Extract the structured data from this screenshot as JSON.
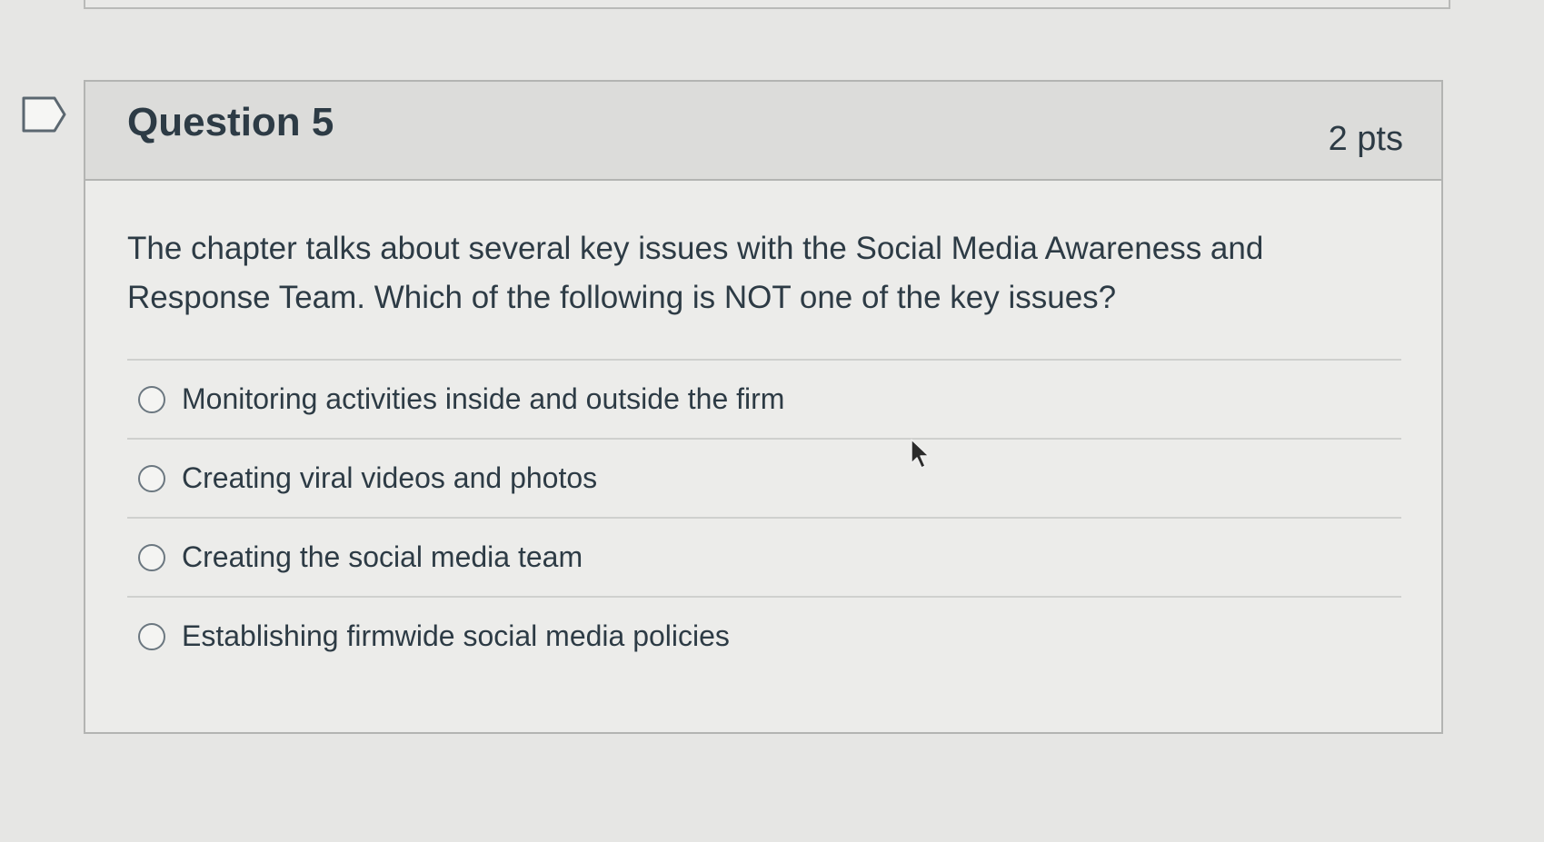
{
  "question": {
    "title": "Question 5",
    "points": "2 pts",
    "text": "The chapter talks about several key issues with the Social Media Awareness and Response Team. Which of the following is NOT one of the key issues?",
    "answers": [
      {
        "label": "Monitoring activities inside and outside the firm",
        "selected": false
      },
      {
        "label": "Creating viral videos and photos",
        "selected": false
      },
      {
        "label": "Creating the social media team",
        "selected": false
      },
      {
        "label": "Establishing firmwide social media policies",
        "selected": false
      }
    ]
  },
  "icons": {
    "flag": "flag-question-icon",
    "cursor": "mouse-pointer-icon"
  },
  "colors": {
    "text": "#2d3b45",
    "header_bg": "#dcdcda",
    "border": "#b3b4b2",
    "page_bg": "#e6e6e4"
  }
}
